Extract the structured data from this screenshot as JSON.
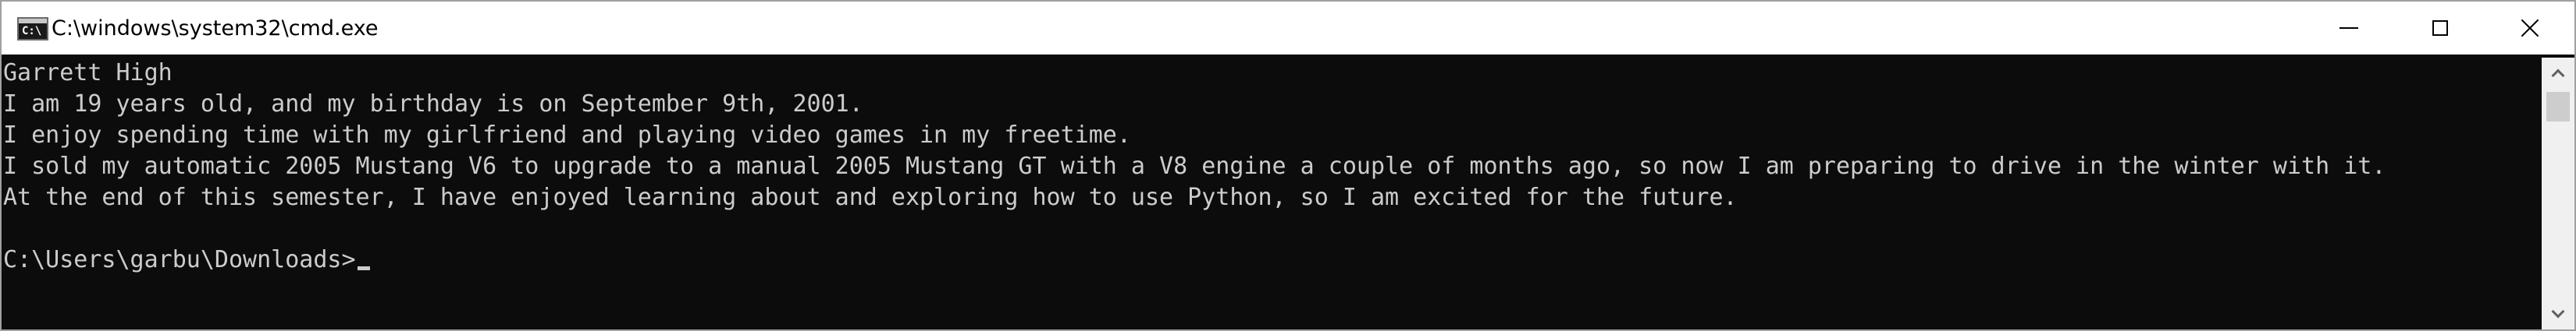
{
  "window": {
    "title": "C:\\windows\\system32\\cmd.exe",
    "app_icon_text": "C:\\"
  },
  "console": {
    "lines": [
      "Garrett High",
      "I am 19 years old, and my birthday is on September 9th, 2001.",
      "I enjoy spending time with my girlfriend and playing video games in my freetime.",
      "I sold my automatic 2005 Mustang V6 to upgrade to a manual 2005 Mustang GT with a V8 engine a couple of months ago, so now I am preparing to drive in the winter with it.",
      "At the end of this semester, I have enjoyed learning about and exploring how to use Python, so I am excited for the future.",
      ""
    ],
    "prompt": "C:\\Users\\garbu\\Downloads>"
  },
  "icons": {
    "app": "cmd-app-icon",
    "minimize": "minimize-icon",
    "maximize": "maximize-icon",
    "close": "close-icon",
    "scroll_up": "chevron-up-icon",
    "scroll_down": "chevron-down-icon"
  },
  "colors": {
    "console_background": "#0c0c0c",
    "console_text": "#cccccc",
    "titlebar_background": "#ffffff"
  }
}
